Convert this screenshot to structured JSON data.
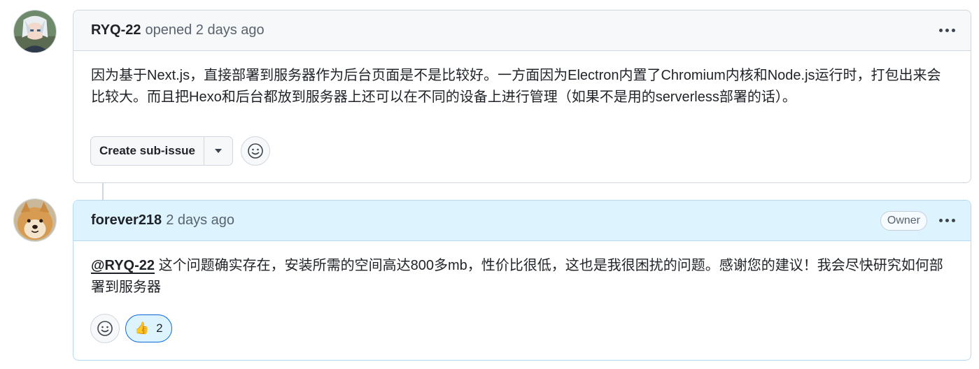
{
  "comments": [
    {
      "author": "RYQ-22",
      "meta": "opened 2 days ago",
      "body": "因为基于Next.js，直接部署到服务器作为后台页面是不是比较好。一方面因为Electron内置了Chromium内核和Node.js运行时，打包出来会比较大。而且把Hexo和后台都放到服务器上还可以在不同的设备上进行管理（如果不是用的serverless部署的话）。",
      "create_sub_issue_label": "Create sub-issue"
    },
    {
      "author": "forever218",
      "meta": "2 days ago",
      "badge": "Owner",
      "mention": "@RYQ-22",
      "body": " 这个问题确实存在，安装所需的空间高达800多mb，性价比很低，这也是我很困扰的问题。感谢您的建议！我会尽快研究如何部署到服务器",
      "reaction": {
        "emoji": "👍",
        "count": "2"
      }
    }
  ],
  "icons": {
    "kebab": "kebab-horizontal-icon",
    "emoji": "smiley-icon",
    "caret": "triangle-down-icon"
  },
  "colors": {
    "header_bg": "#f6f8fa",
    "owner_header_bg": "#ddf4ff",
    "reaction_border": "#0969da",
    "border": "#d0d7de"
  }
}
